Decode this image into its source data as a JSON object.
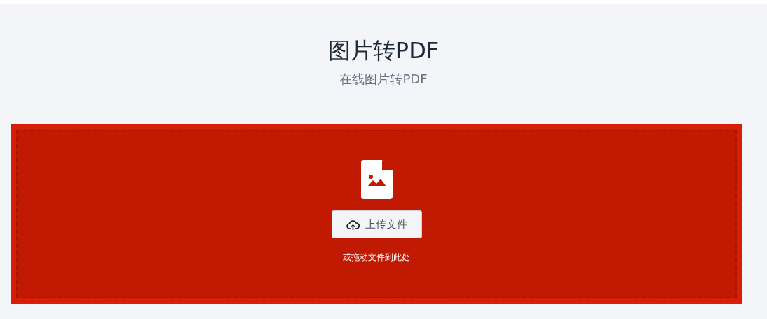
{
  "header": {
    "title": "图片转PDF",
    "subtitle": "在线图片转PDF"
  },
  "dropzone": {
    "upload_button": "上传文件",
    "hint": "或拖动文件到此处"
  }
}
